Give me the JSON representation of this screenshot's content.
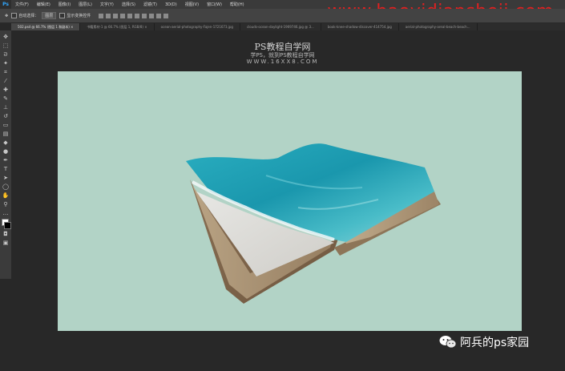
{
  "menubar": {
    "logo": "Ps",
    "items": [
      "文件(F)",
      "编辑(E)",
      "图像(I)",
      "图层(L)",
      "文字(Y)",
      "选择(S)",
      "滤镜(T)",
      "3D(D)",
      "视图(V)",
      "窗口(W)",
      "帮助(H)"
    ],
    "watermark_url": "www.haoyidiansheji.com"
  },
  "options": {
    "auto_select_label": "自动选择：",
    "auto_select_value": "图层",
    "transform_label": "显示变换控件"
  },
  "tabs": [
    {
      "label": "502.psd @ 66.7% (图层 1 和副本) ×",
      "active": true
    },
    {
      "label": "书籍素材-1 @ 66.7% (图层 1, RGB/8) ×",
      "active": false
    },
    {
      "label": "ocean-aerial-photography-Fajen-1721673.jpg",
      "active": false
    },
    {
      "label": "clouds-ocean-daylight-1969746.jpg @ 3...",
      "active": false
    },
    {
      "label": "book-knee-shadow-discover-414754.jpg",
      "active": false
    },
    {
      "label": "aerial-photography-areal-beach-beach...",
      "active": false
    }
  ],
  "tools": [
    {
      "icon": "move-icon",
      "glyph": "✥"
    },
    {
      "icon": "marquee-icon",
      "glyph": "⬚"
    },
    {
      "icon": "lasso-icon",
      "glyph": "ᘐ"
    },
    {
      "icon": "magic-wand-icon",
      "glyph": "✦"
    },
    {
      "icon": "crop-icon",
      "glyph": "⌗"
    },
    {
      "icon": "eyedropper-icon",
      "glyph": "⁄"
    },
    {
      "icon": "healing-brush-icon",
      "glyph": "✚"
    },
    {
      "icon": "brush-icon",
      "glyph": "✎"
    },
    {
      "icon": "clone-stamp-icon",
      "glyph": "⊥"
    },
    {
      "icon": "history-brush-icon",
      "glyph": "↺"
    },
    {
      "icon": "eraser-icon",
      "glyph": "▭"
    },
    {
      "icon": "gradient-icon",
      "glyph": "▤"
    },
    {
      "icon": "blur-icon",
      "glyph": "◆"
    },
    {
      "icon": "dodge-icon",
      "glyph": "●"
    },
    {
      "icon": "pen-icon",
      "glyph": "✒"
    },
    {
      "icon": "type-icon",
      "glyph": "T"
    },
    {
      "icon": "path-selection-icon",
      "glyph": "➤"
    },
    {
      "icon": "shape-icon",
      "glyph": "◯"
    },
    {
      "icon": "hand-icon",
      "glyph": "✋"
    },
    {
      "icon": "zoom-icon",
      "glyph": "⚲"
    },
    {
      "icon": "more-tools-icon",
      "glyph": "…"
    }
  ],
  "canvas": {
    "title": "PS教程自学网",
    "subtitle": "学PS，就到PS教程自学网",
    "site": "WWW.16XX8.COM",
    "background_color": "#b2d3c6"
  },
  "bottom_watermark": {
    "text": "阿兵的ps家园",
    "icon": "wechat-icon"
  }
}
